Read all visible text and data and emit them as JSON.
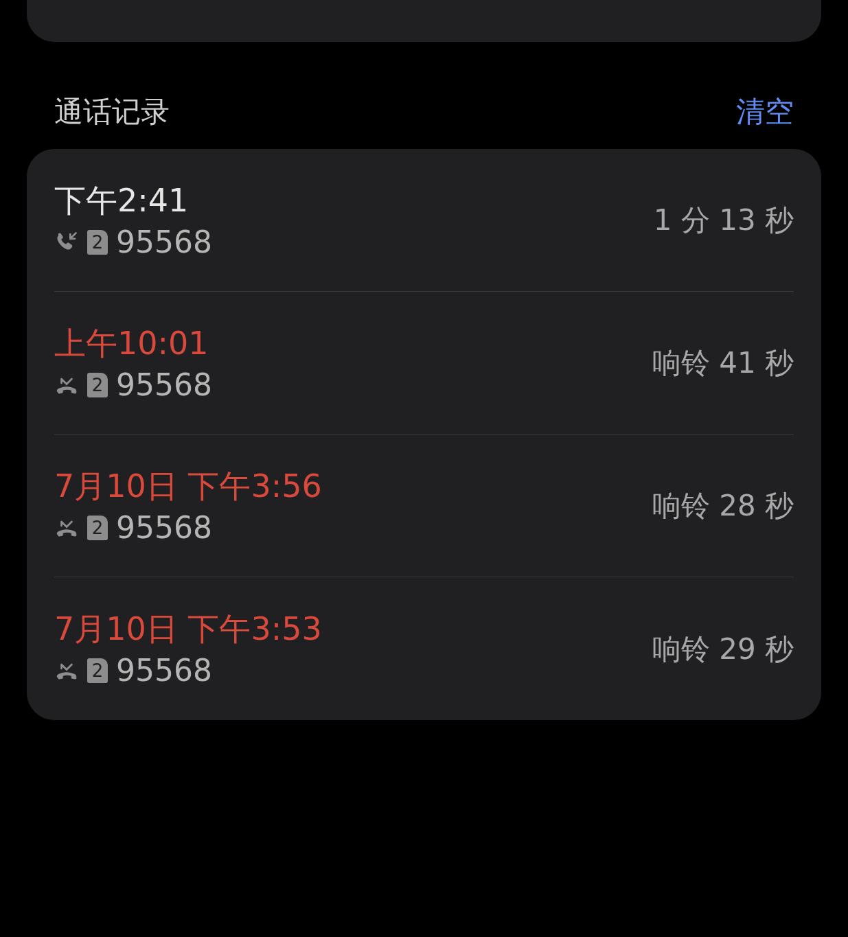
{
  "section": {
    "title": "通话记录",
    "action": "清空"
  },
  "calls": [
    {
      "kind": "incoming",
      "time": "下午2:41",
      "sim": "2",
      "number": "95568",
      "duration": "1 分 13 秒"
    },
    {
      "kind": "missed",
      "time": "上午10:01",
      "sim": "2",
      "number": "95568",
      "duration": "响铃 41 秒"
    },
    {
      "kind": "missed",
      "time": "7月10日 下午3:56",
      "sim": "2",
      "number": "95568",
      "duration": "响铃 28 秒"
    },
    {
      "kind": "missed",
      "time": "7月10日 下午3:53",
      "sim": "2",
      "number": "95568",
      "duration": "响铃 29 秒"
    }
  ]
}
